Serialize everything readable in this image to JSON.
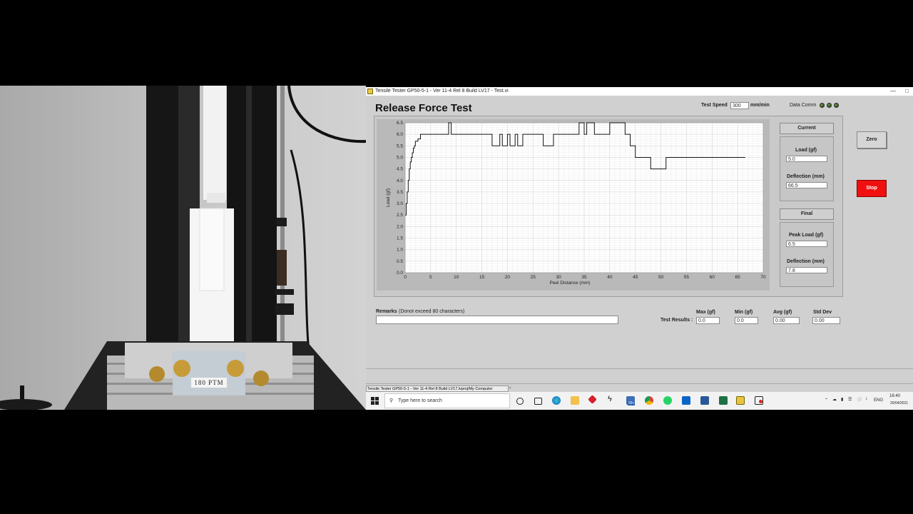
{
  "window": {
    "title": "Tensile Tester GP50-5-1 - Ver 11-4 Rel 8 Build LV17 - Test.vi"
  },
  "header": {
    "page_title": "Release Force Test",
    "test_speed_label": "Test Speed",
    "test_speed_value": "300",
    "test_speed_unit": "mm/min",
    "data_comm_label": "Data Comm"
  },
  "photo": {
    "plate_label": "180 PTM"
  },
  "chart_data": {
    "type": "line",
    "xlabel": "Peel Distance (mm)",
    "ylabel": "Load (gf)",
    "xlim": [
      0,
      70
    ],
    "ylim": [
      0,
      6.5
    ],
    "x_ticks": [
      "0",
      "5",
      "10",
      "15",
      "20",
      "25",
      "30",
      "35",
      "40",
      "45",
      "50",
      "55",
      "60",
      "65",
      "70"
    ],
    "y_ticks": [
      "0.0",
      "0.5",
      "1.0",
      "1.5",
      "2.0",
      "2.5",
      "3.0",
      "3.5",
      "4.0",
      "4.5",
      "5.0",
      "5.5",
      "6.0",
      "6.5"
    ],
    "grid": true,
    "series": [
      {
        "x": [
          0,
          0.2,
          0.4,
          0.6,
          0.8,
          1.0,
          1.2,
          1.4,
          1.6,
          1.8,
          2.0,
          2.5,
          3,
          8,
          8.5,
          9,
          15,
          17,
          18,
          18.5,
          19,
          19.5,
          20,
          20.5,
          21,
          21.5,
          22,
          23,
          24,
          27,
          29,
          30,
          31,
          32,
          34,
          35,
          35.5,
          36,
          37,
          39,
          40,
          43,
          44,
          45,
          46,
          48,
          49,
          50,
          51,
          52,
          55,
          60,
          66.5
        ],
        "y": [
          2.5,
          3.0,
          3.5,
          4.0,
          4.5,
          4.8,
          5.0,
          5.2,
          5.4,
          5.5,
          5.7,
          5.8,
          6.0,
          6.0,
          6.5,
          6.0,
          6.0,
          5.5,
          5.5,
          6.0,
          5.5,
          5.5,
          6.0,
          5.5,
          5.5,
          6.0,
          5.5,
          6.0,
          6.0,
          5.5,
          6.0,
          6.0,
          6.0,
          6.0,
          6.5,
          6.0,
          6.5,
          6.5,
          6.0,
          6.0,
          6.5,
          6.0,
          5.5,
          5.0,
          5.0,
          4.5,
          4.5,
          4.5,
          5.0,
          5.0,
          5.0,
          5.0,
          5.0
        ]
      }
    ]
  },
  "current": {
    "section_label": "Current",
    "load_label": "Load (gf)",
    "load_value": "5.0",
    "deflection_label": "Deflection (mm)",
    "deflection_value": "66.5"
  },
  "final": {
    "section_label": "Final",
    "peak_load_label": "Peak Load (gf)",
    "peak_load_value": "6.5",
    "deflection_label": "Deflection (mm)",
    "deflection_value": "7.8"
  },
  "buttons": {
    "zero": "Zero",
    "stop": "Stop"
  },
  "remarks": {
    "label": "Remarks",
    "hint": "(Donot exceed 80 characters)",
    "value": ""
  },
  "results": {
    "row_label": "Test Results :",
    "max_label": "Max (gf)",
    "max_value": "0.0",
    "min_label": "Min (gf)",
    "min_value": "0.0",
    "avg_label": "Avg (gf)",
    "avg_value": "0.00",
    "std_label": "Std Dev",
    "std_value": "0.00"
  },
  "statusbar": {
    "path": "Tensile Tester GP50-5-1 - Ver 11-4 Rel 8 Build LV17.lvproj/My Computer"
  },
  "taskbar": {
    "search_placeholder": "Type here to search",
    "badge": "99+",
    "lang": "ENG",
    "time": "16:40",
    "date": "20/04/2021"
  },
  "colors": {
    "stop_button": "#f01010",
    "led": "#3f6b24",
    "panel": "#d0d0d0"
  }
}
